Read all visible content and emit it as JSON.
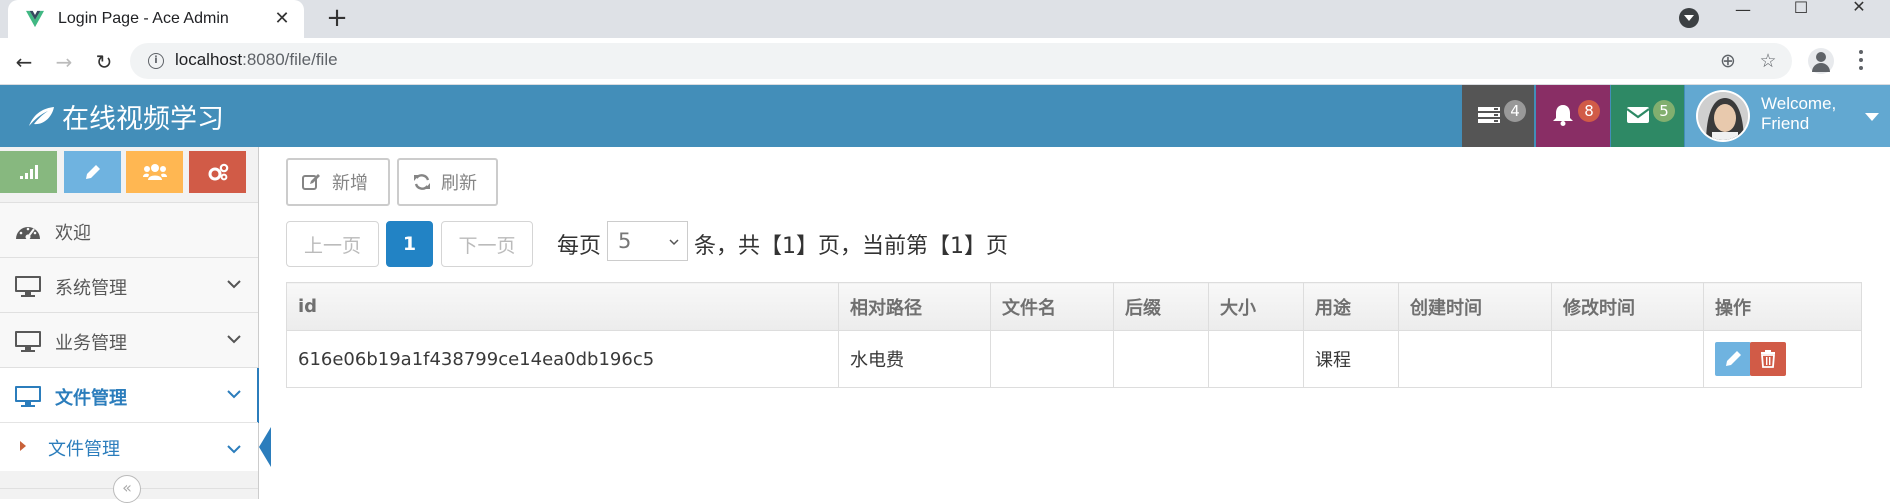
{
  "browser": {
    "tab_title": "Login Page - Ace Admin",
    "url_host": "localhost",
    "url_path": ":8080/file/file"
  },
  "navbar": {
    "brand": "在线视频学习",
    "tasks_count": "4",
    "notifications_count": "8",
    "messages_count": "5",
    "welcome_line1": "Welcome,",
    "welcome_line2": "Friend",
    "colors": {
      "bar": "#438eb9",
      "tasks": "#555555",
      "notifications": "#892e65",
      "messages": "#2e8965",
      "user": "#62a8d1"
    }
  },
  "sidebar": {
    "items": [
      {
        "label": "欢迎",
        "icon": "dashboard-icon"
      },
      {
        "label": "系统管理",
        "icon": "desktop-icon"
      },
      {
        "label": "业务管理",
        "icon": "desktop-icon"
      },
      {
        "label": "文件管理",
        "icon": "desktop-icon",
        "active": true
      }
    ],
    "submenu": {
      "label": "文件管理"
    },
    "collapse_glyph": "«"
  },
  "toolbar": {
    "add_label": "新增",
    "refresh_label": "刷新"
  },
  "pagination": {
    "prev_label": "上一页",
    "current_page": "1",
    "next_label": "下一页",
    "per_page_prefix": "每页",
    "page_size": "5",
    "summary": "条，共【1】页，当前第【1】页"
  },
  "table": {
    "headers": [
      "id",
      "相对路径",
      "文件名",
      "后缀",
      "大小",
      "用途",
      "创建时间",
      "修改时间",
      "操作"
    ],
    "rows": [
      [
        "616e06b19a1f438799ce14ea0db196c5",
        "水电费",
        "",
        "",
        "",
        "课程",
        "",
        ""
      ]
    ]
  }
}
